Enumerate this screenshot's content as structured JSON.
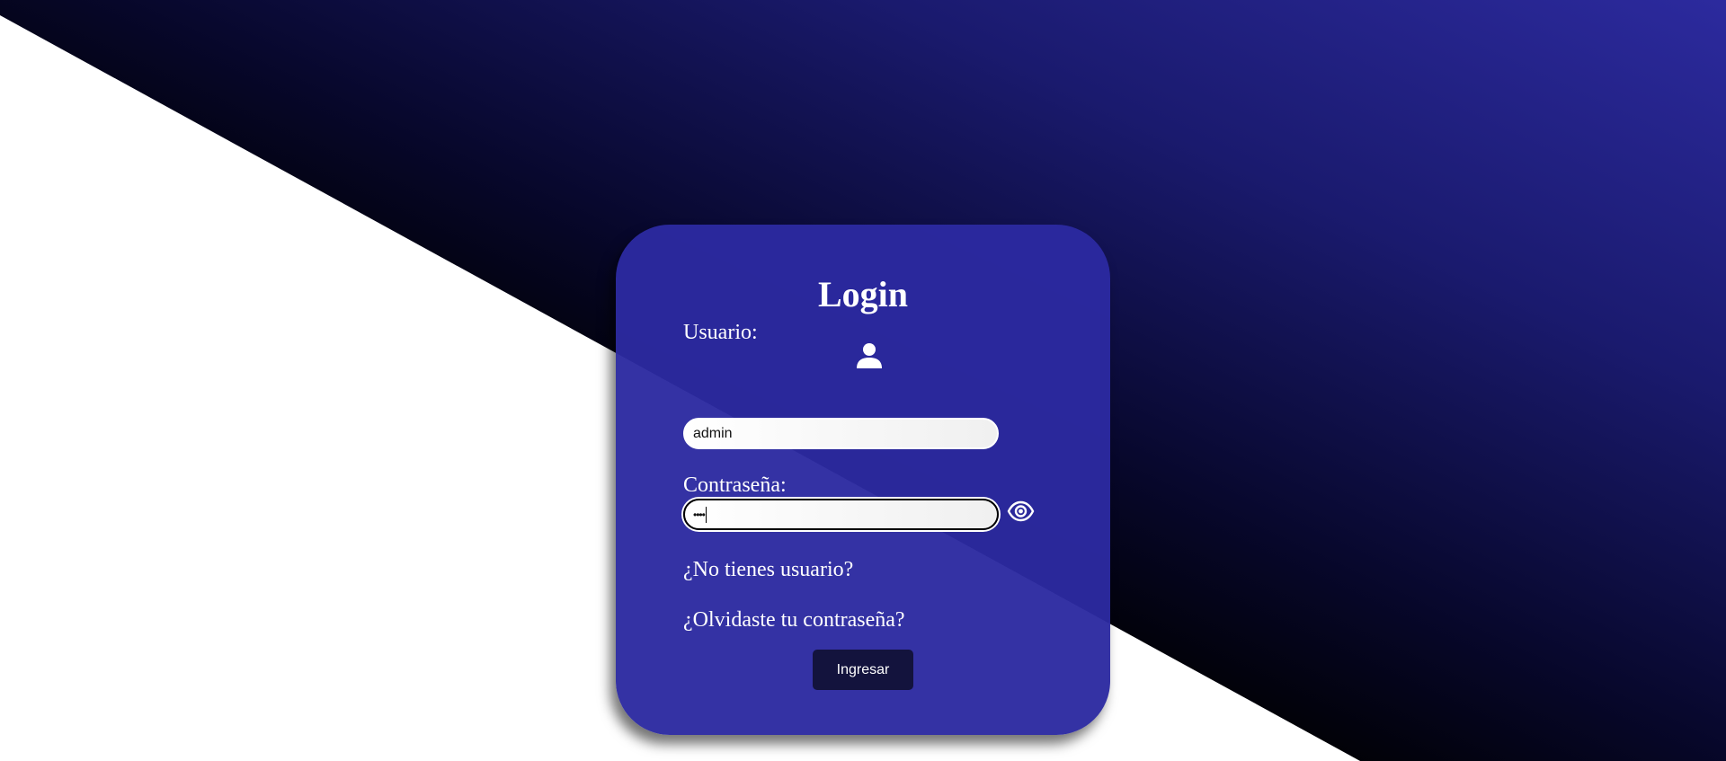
{
  "login": {
    "title": "Login",
    "username_label": "Usuario:",
    "username_value": "admin",
    "password_label": "Contraseña:",
    "password_masked": "••••",
    "no_user_link": "¿No tienes usuario?",
    "forgot_password_link": "¿Olvidaste tu contraseña?",
    "submit_label": "Ingresar"
  },
  "icons": {
    "user": "user-icon",
    "eye": "eye-icon"
  },
  "colors": {
    "card": "#2c2aa0",
    "button": "#13133d",
    "background_dark": "#000000",
    "background_accent": "#2c2a9e",
    "background_light": "#ffffff"
  }
}
